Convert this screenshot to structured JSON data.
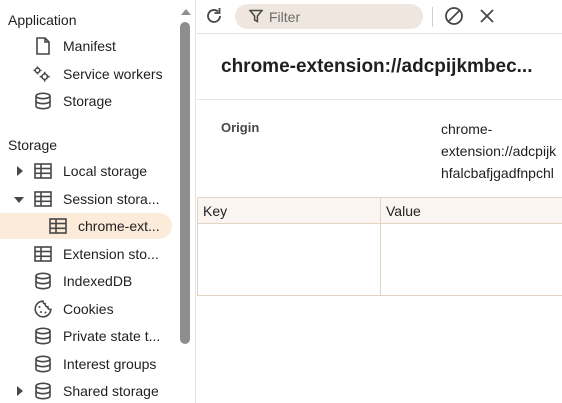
{
  "sidebar": {
    "application_header": "Application",
    "application_items": [
      {
        "label": "Manifest",
        "icon": "document-icon"
      },
      {
        "label": "Service workers",
        "icon": "gears-icon"
      },
      {
        "label": "Storage",
        "icon": "database-icon"
      }
    ],
    "storage_header": "Storage",
    "storage_items": [
      {
        "label": "Local storage",
        "icon": "table-icon",
        "expandable": true,
        "expanded": false
      },
      {
        "label": "Session stora...",
        "icon": "table-icon",
        "expandable": true,
        "expanded": true
      },
      {
        "label": "chrome-ext...",
        "icon": "table-icon",
        "selected": true
      },
      {
        "label": "Extension sto...",
        "icon": "table-icon"
      },
      {
        "label": "IndexedDB",
        "icon": "database-icon"
      },
      {
        "label": "Cookies",
        "icon": "cookie-icon"
      },
      {
        "label": "Private state t...",
        "icon": "database-icon"
      },
      {
        "label": "Interest groups",
        "icon": "database-icon"
      },
      {
        "label": "Shared storage",
        "icon": "database-icon",
        "expandable": true,
        "expanded": false
      }
    ]
  },
  "toolbar": {
    "filter_placeholder": "Filter",
    "refresh_icon": "refresh-icon",
    "clear_icon": "clear-icon",
    "close_icon": "close-icon"
  },
  "main": {
    "title": "chrome-extension://adcpijkmbec...",
    "origin_label": "Origin",
    "origin_lines": [
      "chrome-",
      "extension://adcpijk",
      "hfalcbafjgadfnpchl"
    ]
  },
  "grid": {
    "columns": [
      "Key",
      "Value"
    ],
    "rows": []
  },
  "colors": {
    "selected_bg": "#fdebd9",
    "filter_bg": "#efe7df",
    "grid_border": "#e3d3c3"
  }
}
